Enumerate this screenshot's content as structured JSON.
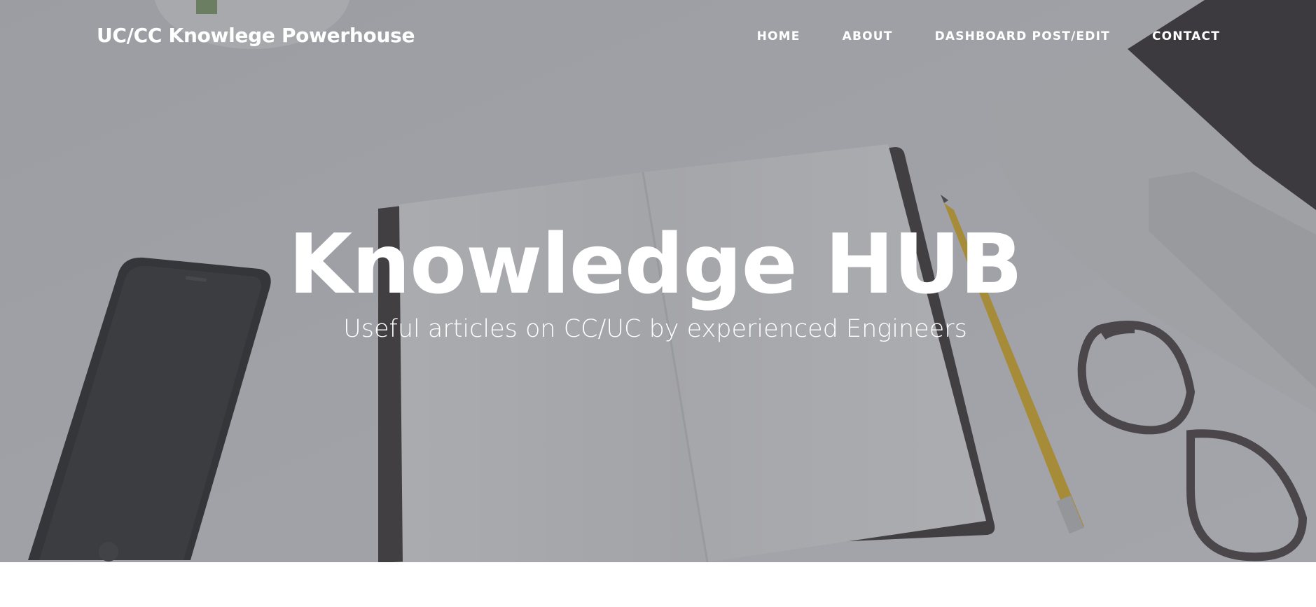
{
  "nav": {
    "brand": "UC/CC Knowlege Powerhouse",
    "links": [
      {
        "label": "HOME"
      },
      {
        "label": "ABOUT"
      },
      {
        "label": "DASHBOARD POST/EDIT"
      },
      {
        "label": "CONTACT"
      }
    ]
  },
  "masthead": {
    "heading": "Knowledge HUB",
    "subheading": "Useful articles on CC/UC by experienced Engineers"
  },
  "colors": {
    "overlay": "#5f6168",
    "text": "#ffffff",
    "page_background": "#ffffff"
  }
}
